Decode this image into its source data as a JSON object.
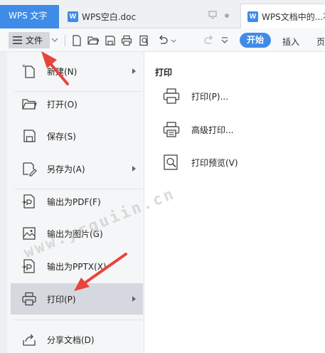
{
  "tabs": {
    "app_label": "WPS 文字",
    "doc_title": "WPS空白.doc",
    "doc2_title": "WPS文档中的...不"
  },
  "toolbar": {
    "file_label": "文件",
    "start_label": "开始",
    "insert_label": "插入",
    "page_label": "页",
    "icons": [
      "new-doc-icon",
      "open-folder-icon",
      "save-icon",
      "print-icon",
      "print-preview-icon",
      "undo-icon",
      "redo-icon",
      "more-icon"
    ]
  },
  "file_menu": {
    "items": [
      {
        "label": "新建(N)",
        "icon": "new-icon",
        "has_submenu": true
      },
      {
        "label": "打开(O)",
        "icon": "open-icon",
        "has_submenu": false
      },
      {
        "label": "保存(S)",
        "icon": "save-icon",
        "has_submenu": false
      },
      {
        "label": "另存为(A)",
        "icon": "save-as-icon",
        "has_submenu": true
      },
      {
        "label": "输出为PDF(F)",
        "icon": "export-pdf-icon",
        "has_submenu": false
      },
      {
        "label": "输出为图片(G)",
        "icon": "export-image-icon",
        "has_submenu": false
      },
      {
        "label": "输出为PPTX(X)",
        "icon": "export-pptx-icon",
        "has_submenu": false
      },
      {
        "label": "打印(P)",
        "icon": "print-icon",
        "has_submenu": true,
        "active": true
      },
      {
        "label": "分享文档(D)",
        "icon": "share-icon",
        "has_submenu": false
      }
    ]
  },
  "print_submenu": {
    "title": "打印",
    "items": [
      {
        "label": "打印(P)...",
        "icon": "print-icon"
      },
      {
        "label": "高级打印...",
        "icon": "advanced-print-icon"
      },
      {
        "label": "打印预览(V)",
        "icon": "print-preview-icon"
      }
    ]
  },
  "watermark": "www.yrguiin.cn",
  "colors": {
    "accent": "#3f8be8",
    "annotation_arrow": "#e8443a",
    "active_item": "#d5d8de"
  }
}
